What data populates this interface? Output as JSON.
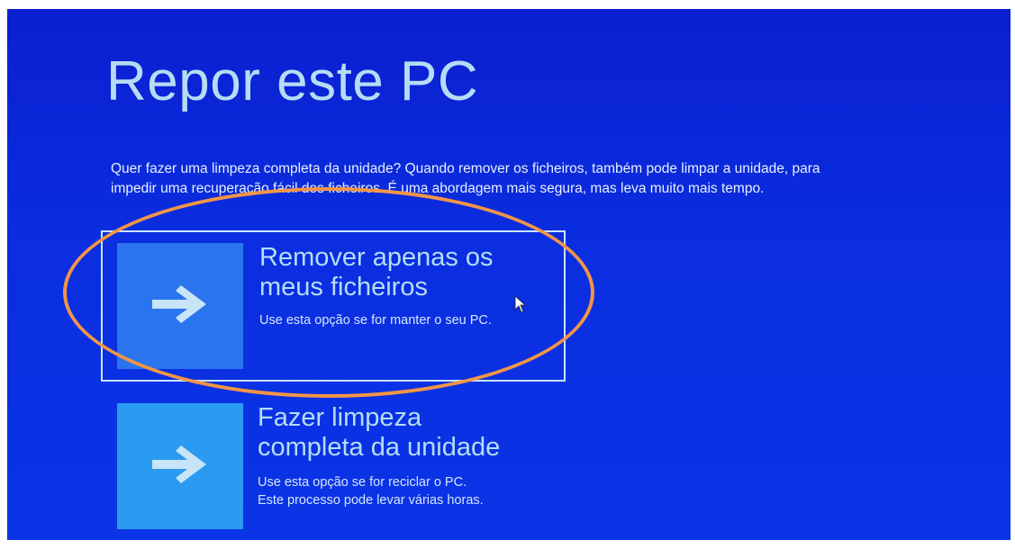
{
  "page": {
    "title": "Repor este PC",
    "description_line1": "Quer fazer uma limpeza completa da unidade? Quando remover os ficheiros, também pode limpar a unidade, para",
    "description_line2": "impedir uma recuperação fácil dos ficheiros. É uma abordagem mais segura, mas leva muito mais tempo."
  },
  "options": [
    {
      "title_line1": "Remover apenas os",
      "title_line2": "meus ficheiros",
      "desc_line1": "Use esta opção se for manter o seu PC.",
      "icon": "arrow-right-icon"
    },
    {
      "title_line1": "Fazer limpeza",
      "title_line2": "completa da unidade",
      "desc_line1": "Use esta opção se for reciclar o PC.",
      "desc_line2": "Este processo pode levar várias horas.",
      "icon": "arrow-right-icon"
    }
  ],
  "colors": {
    "background": "#0a2ee0",
    "title_text": "#b6dcf6",
    "tile_selected": "#2a74ee",
    "tile": "#2a9bf0",
    "annotation": "#f39546"
  }
}
